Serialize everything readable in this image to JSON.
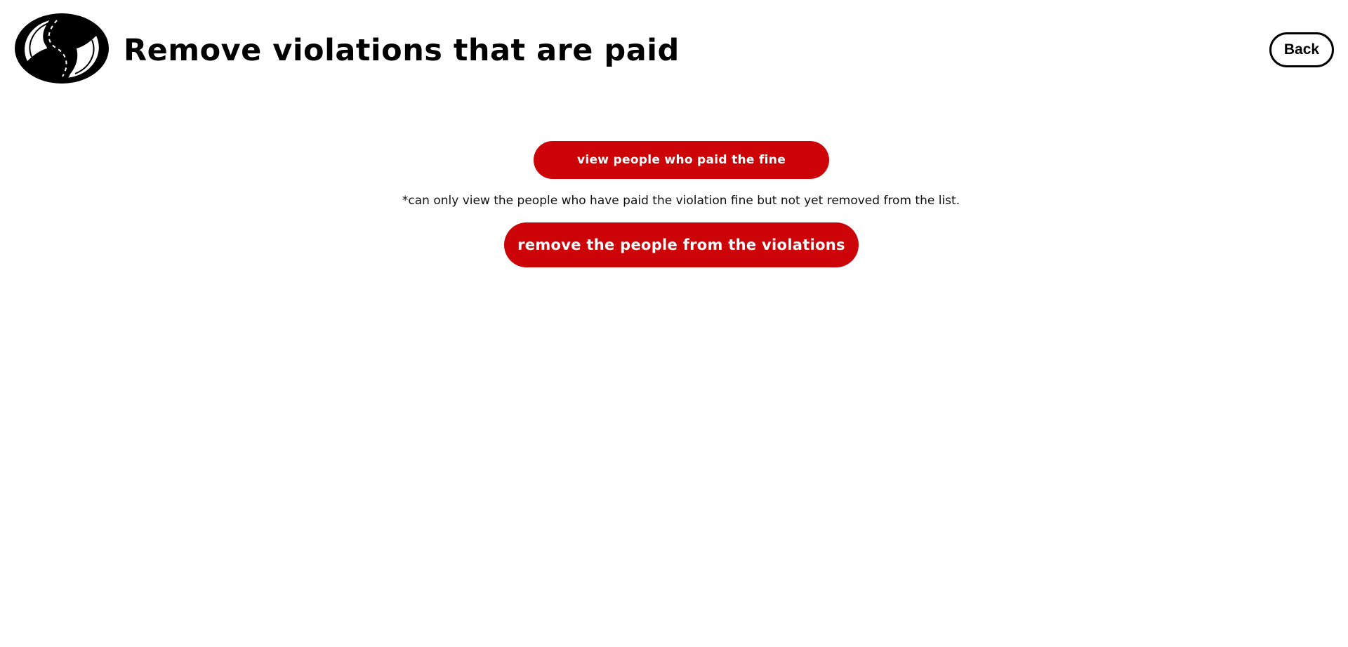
{
  "header": {
    "title": "Remove violations that are paid",
    "back_label": "Back",
    "logo_icon": "road-s-logo-icon"
  },
  "actions": {
    "view_paid_label": "view people who paid the fine",
    "note": "*can only view the people who have paid the violation fine but not yet removed from the list.",
    "remove_label": "remove the people from the violations"
  },
  "colors": {
    "accent": "#cc0408",
    "background": "#ffffff",
    "text": "#000000"
  }
}
